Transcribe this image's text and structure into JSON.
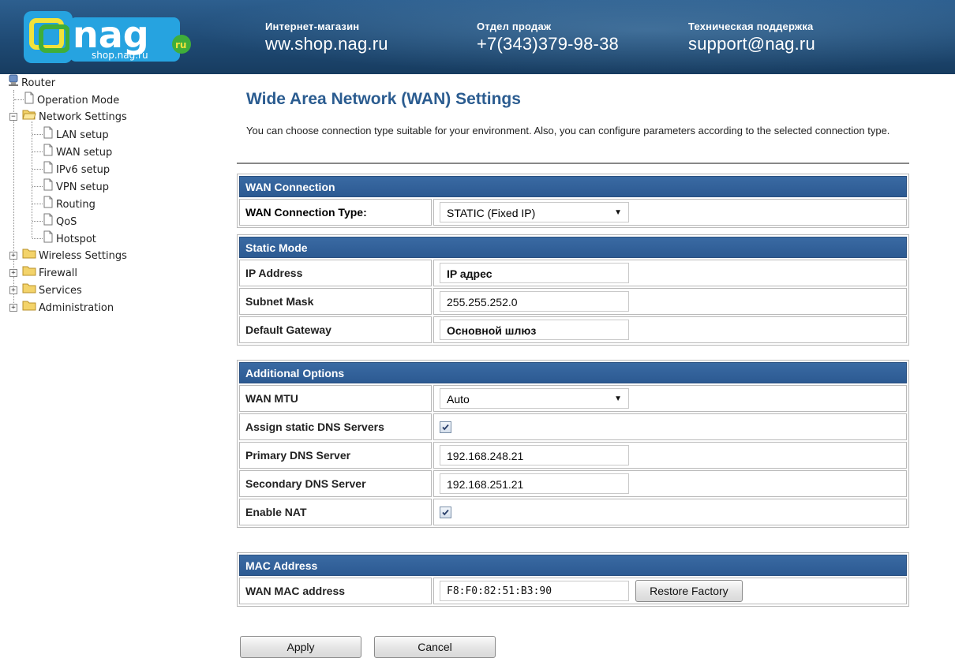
{
  "banner": {
    "logo_text": "nag",
    "logo_sub": "shop.nag.ru",
    "logo_badge": "ru",
    "shop_label": "Интернет-магазин",
    "shop_value": "ww.shop.nag.ru",
    "sales_label": "Отдел продаж",
    "sales_value": "+7(343)379-98-38",
    "support_label": "Техническая поддержка",
    "support_value": "support@nag.ru"
  },
  "tree": {
    "root": "Router",
    "operation_mode": "Operation Mode",
    "network_settings": "Network Settings",
    "lan": "LAN setup",
    "wan": "WAN setup",
    "ipv6": "IPv6 setup",
    "vpn": "VPN setup",
    "routing": "Routing",
    "qos": "QoS",
    "hotspot": "Hotspot",
    "wireless": "Wireless Settings",
    "firewall": "Firewall",
    "services": "Services",
    "administration": "Administration"
  },
  "page": {
    "title": "Wide Area Network (WAN) Settings",
    "description": "You can choose connection type suitable for your environment. Also, you can configure parameters according to the selected connection type."
  },
  "wan_connection": {
    "header": "WAN Connection",
    "type_label": "WAN Connection Type:",
    "type_value": "STATIC (Fixed IP)"
  },
  "static_mode": {
    "header": "Static Mode",
    "ip_label": "IP Address",
    "ip_value": "IP адрес",
    "mask_label": "Subnet Mask",
    "mask_value": "255.255.252.0",
    "gateway_label": "Default Gateway",
    "gateway_value": "Основной шлюз"
  },
  "additional": {
    "header": "Additional Options",
    "mtu_label": "WAN MTU",
    "mtu_value": "Auto",
    "dns_assign_label": "Assign static DNS Servers",
    "dns_assign_checked": true,
    "primary_dns_label": "Primary DNS Server",
    "primary_dns_value": "192.168.248.21",
    "secondary_dns_label": "Secondary DNS Server",
    "secondary_dns_value": "192.168.251.21",
    "nat_label": "Enable NAT",
    "nat_checked": true
  },
  "mac": {
    "header": "MAC Address",
    "label": "WAN MAC address",
    "value": "F8:F0:82:51:B3:90",
    "restore_label": "Restore Factory"
  },
  "actions": {
    "apply_label": "Apply",
    "cancel_label": "Cancel"
  },
  "colors": {
    "banner": "#1f4a74",
    "section_header": "#2c5a92",
    "title": "#2b5c90"
  }
}
